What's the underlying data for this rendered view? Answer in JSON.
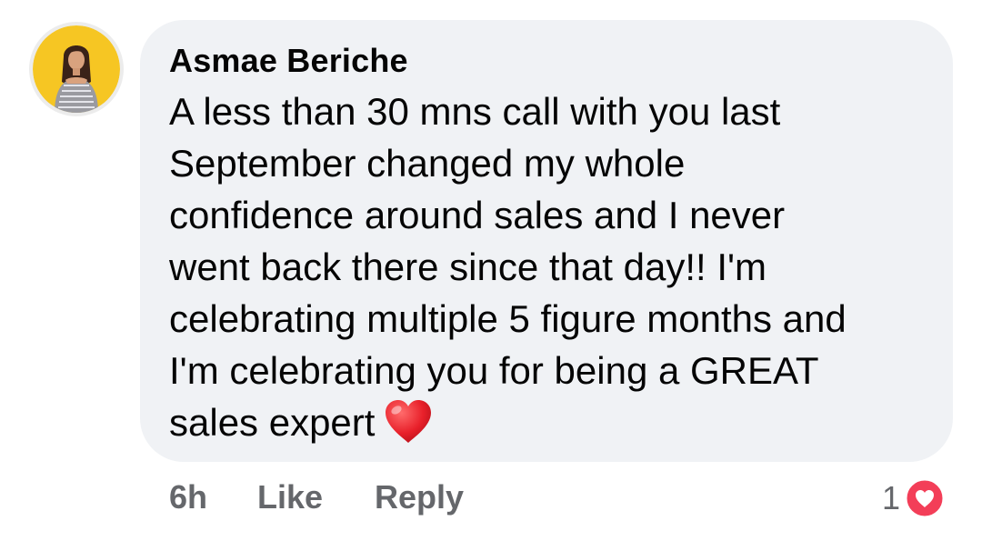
{
  "comment": {
    "author": "Asmae Beriche",
    "lines": [
      "A less than 30 mns call with you last",
      "September changed my whole",
      "confidence around sales and I never",
      "went back there since that day!! I'm",
      "celebrating multiple 5 figure months and",
      "I'm celebrating you for being a GREAT",
      "sales expert"
    ],
    "emoji": "red-heart",
    "avatar": "profile-photo"
  },
  "actions": {
    "time": "6h",
    "like_label": "Like",
    "reply_label": "Reply"
  },
  "reactions": {
    "count": "1",
    "type": "love",
    "color": "#f33e58"
  },
  "colors": {
    "bubble": "#f0f2f5",
    "text": "#050505",
    "secondary": "#65676b",
    "avatar_bg": "#f6c623"
  }
}
